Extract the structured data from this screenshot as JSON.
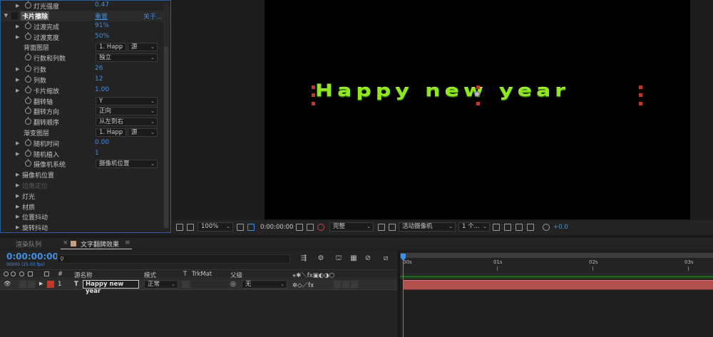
{
  "effect_controls": {
    "rows": [
      {
        "label": "灯光强度",
        "value": "0.47"
      },
      {
        "label": "卡片擦除",
        "value": "重置",
        "extra": "关于..."
      },
      {
        "label": "过渡完成",
        "value": "91%"
      },
      {
        "label": "过渡宽度",
        "value": "50%"
      },
      {
        "label": "背面图层",
        "dropdown1": "1. Happ",
        "dropdown2": "源"
      },
      {
        "label": "行数和列数",
        "dropdown1": "独立"
      },
      {
        "label": "行数",
        "value": "26"
      },
      {
        "label": "列数",
        "value": "12"
      },
      {
        "label": "卡片缩放",
        "value": "1.00"
      },
      {
        "label": "翻转轴",
        "dropdown1": "Y"
      },
      {
        "label": "翻转方向",
        "dropdown1": "正向"
      },
      {
        "label": "翻转顺序",
        "dropdown1": "从左到右"
      },
      {
        "label": "渐变图层",
        "dropdown1": "1. Happ",
        "dropdown2": "源"
      },
      {
        "label": "随机时间",
        "value": "0.00"
      },
      {
        "label": "随机植入",
        "value": "1"
      },
      {
        "label": "摄像机系统",
        "dropdown1": "摄像机位置"
      },
      {
        "label": "摄像机位置"
      },
      {
        "label": "边角定位"
      },
      {
        "label": "灯光"
      },
      {
        "label": "材质"
      },
      {
        "label": "位置抖动"
      },
      {
        "label": "旋转抖动"
      }
    ]
  },
  "composition": {
    "text": "Happy new year",
    "text_color": "#8ee81c"
  },
  "viewer_toolbar": {
    "zoom": "100%",
    "timecode": "0:00:00:00",
    "resolution": "完整",
    "camera": "活动摄像机",
    "views": "1 个...",
    "exposure": "+0.0"
  },
  "timeline": {
    "tabs": [
      "渲染队列",
      "文字翻牌效果"
    ],
    "tab_close": "×",
    "tab_menu": "≡",
    "timecode": "0:00:00:00",
    "fps": "00000 (25.00 fps)",
    "search_placeholder": "",
    "columns": {
      "hash": "#",
      "source_name": "源名称",
      "mode": "模式",
      "t": "T",
      "trkmat": "TrkMat",
      "parent": "父级"
    },
    "layer": {
      "number": "1",
      "type": "T",
      "name": "Happy new year",
      "mode": "正常",
      "parent": "无",
      "label_color": "#c0392b"
    },
    "ruler_labels": [
      "00s",
      "01s",
      "02s",
      "03s"
    ],
    "accent": "#3f8fe3"
  }
}
